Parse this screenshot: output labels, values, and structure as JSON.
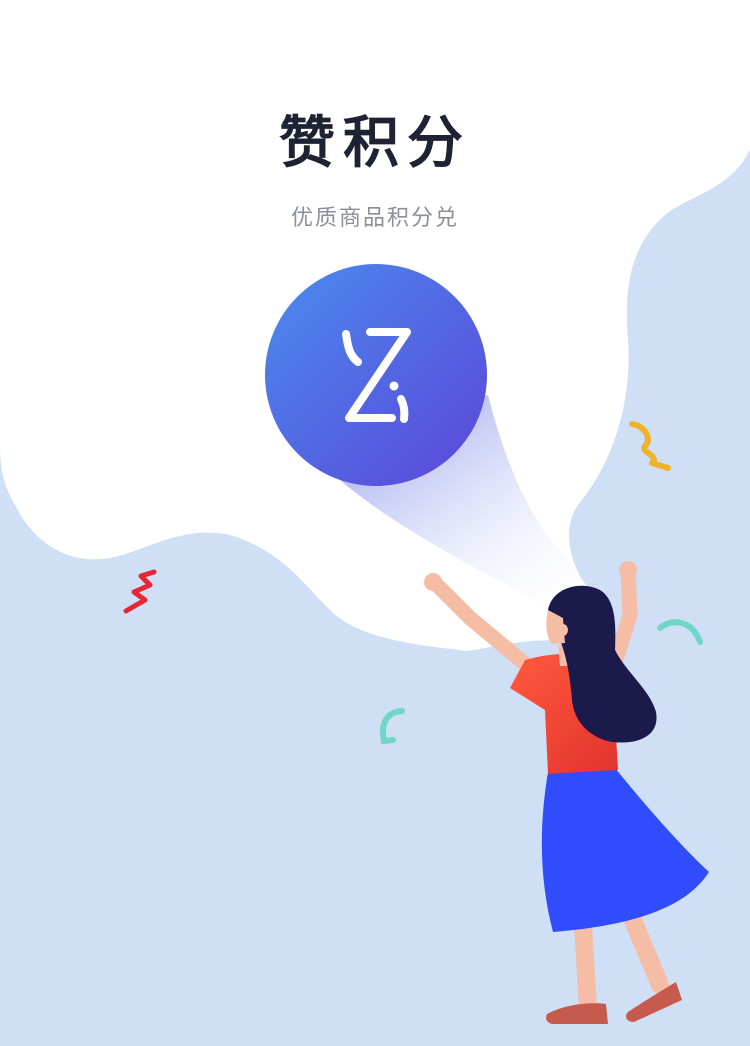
{
  "splash": {
    "title": "赞积分",
    "subtitle": "优质商品积分兑"
  },
  "logo": {
    "icon": "z-logo-icon"
  },
  "colors": {
    "background": "#cfdff6",
    "cloud": "#ffffff",
    "title": "#1d2333",
    "subtitle": "#8a8f99",
    "logo_gradient_start": "#4a8cee",
    "logo_gradient_end": "#5b45d8",
    "shirt": "#f04537",
    "skirt": "#2f4dfd",
    "hair": "#1b1a4a",
    "skin": "#f5bda6",
    "shoes": "#c65a4d"
  }
}
